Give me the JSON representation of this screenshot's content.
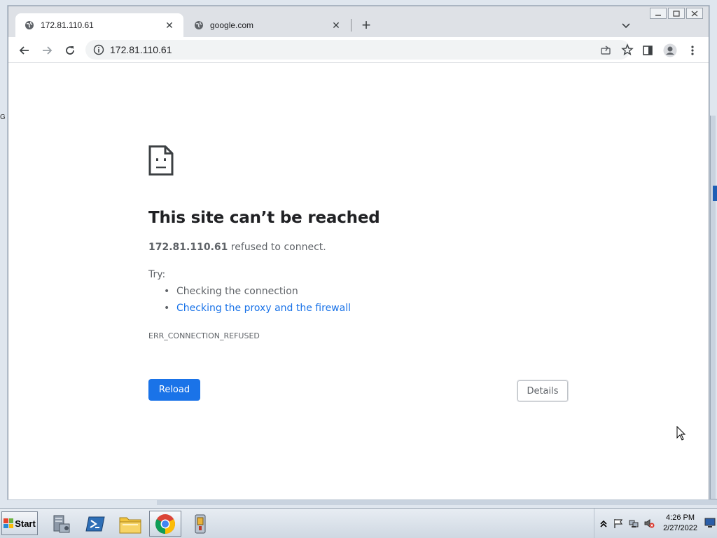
{
  "desktop": {
    "bg_label": "G"
  },
  "browser": {
    "tabs": [
      {
        "title": "172.81.110.61",
        "active": true
      },
      {
        "title": "google.com",
        "active": false
      }
    ],
    "address": "172.81.110.61"
  },
  "error_page": {
    "title": "This site can’t be reached",
    "host": "172.81.110.61",
    "message": "refused to connect.",
    "try_label": "Try:",
    "suggestions": [
      {
        "text": "Checking the connection",
        "link": false
      },
      {
        "text": "Checking the proxy and the firewall",
        "link": true
      }
    ],
    "error_code": "ERR_CONNECTION_REFUSED",
    "reload_label": "Reload",
    "details_label": "Details"
  },
  "taskbar": {
    "start_label": "Start",
    "apps": [
      "server-manager-icon",
      "powershell-icon",
      "file-explorer-icon",
      "chrome-icon",
      "tool-icon"
    ],
    "active_app": "chrome-icon",
    "clock": {
      "time": "4:26 PM",
      "date": "2/27/2022"
    }
  },
  "colors": {
    "accent": "#1a73e8",
    "tabstrip": "#dee1e6",
    "omnibox": "#f1f3f4"
  }
}
